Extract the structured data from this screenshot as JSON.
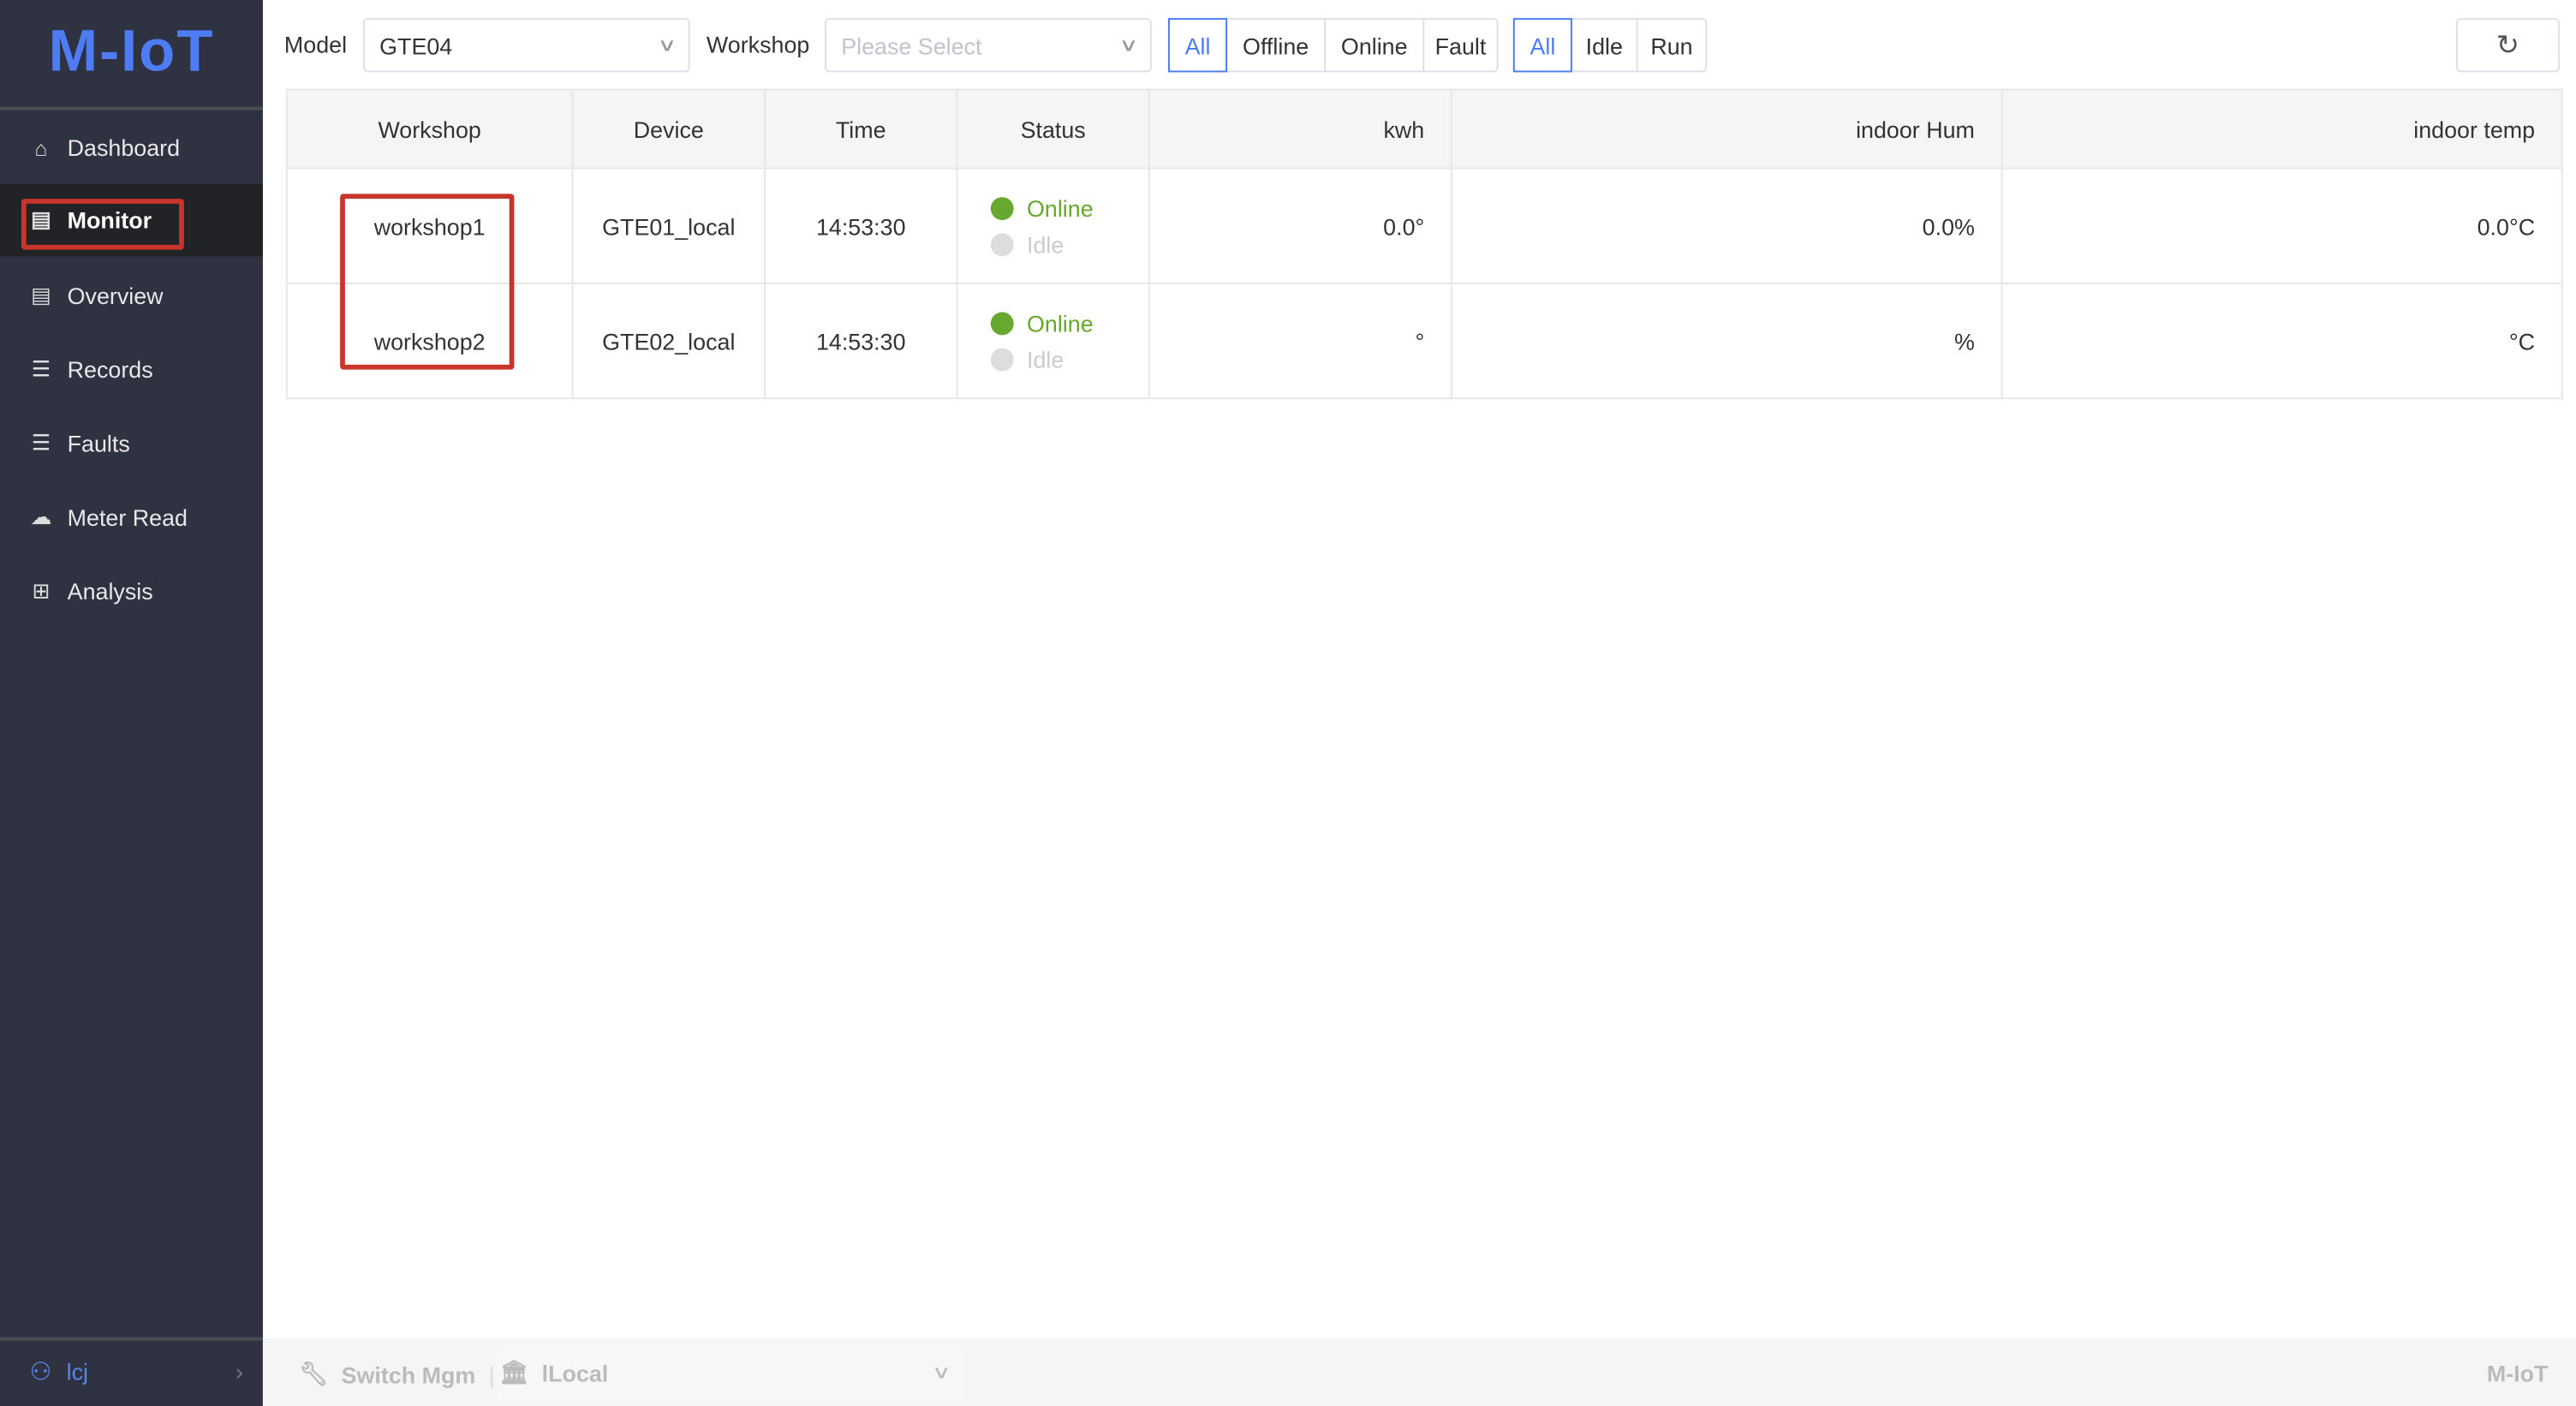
{
  "app": {
    "logo": "M-IoT",
    "footer_brand": "M-IoT"
  },
  "sidebar": {
    "items": [
      {
        "label": "Dashboard",
        "icon": "home-icon"
      },
      {
        "label": "Monitor",
        "icon": "list-icon",
        "active": true
      },
      {
        "label": "Overview",
        "icon": "list-icon"
      },
      {
        "label": "Records",
        "icon": "document-icon"
      },
      {
        "label": "Faults",
        "icon": "document-icon"
      },
      {
        "label": "Meter Read",
        "icon": "cloud-icon"
      },
      {
        "label": "Analysis",
        "icon": "grid-icon"
      }
    ],
    "user": "lcj"
  },
  "filters": {
    "model_label": "Model",
    "model_value": "GTE04",
    "workshop_label": "Workshop",
    "workshop_placeholder": "Please Select",
    "status_group": [
      "All",
      "Offline",
      "Online",
      "Fault"
    ],
    "status_selected": "All",
    "run_group": [
      "All",
      "Idle",
      "Run"
    ],
    "run_selected": "All"
  },
  "table": {
    "headers": [
      "Workshop",
      "Device",
      "Time",
      "Status",
      "kwh",
      "indoor Hum",
      "indoor temp"
    ],
    "rows": [
      {
        "workshop": "workshop1",
        "device": "GTE01_local",
        "time": "14:53:30",
        "status": "Online",
        "substatus": "Idle",
        "kwh": "0.0°",
        "hum": "0.0%",
        "temp": "0.0°C"
      },
      {
        "workshop": "workshop2",
        "device": "GTE02_local",
        "time": "14:53:30",
        "status": "Online",
        "substatus": "Idle",
        "kwh": "°",
        "hum": "%",
        "temp": "°C"
      }
    ]
  },
  "footer": {
    "switch_label": "Switch Mgm",
    "org": "lLocal"
  },
  "colors": {
    "accent": "#4d7cf5",
    "online": "#67a82e",
    "highlight": "#c8362b",
    "sidebar": "#2f3240"
  }
}
